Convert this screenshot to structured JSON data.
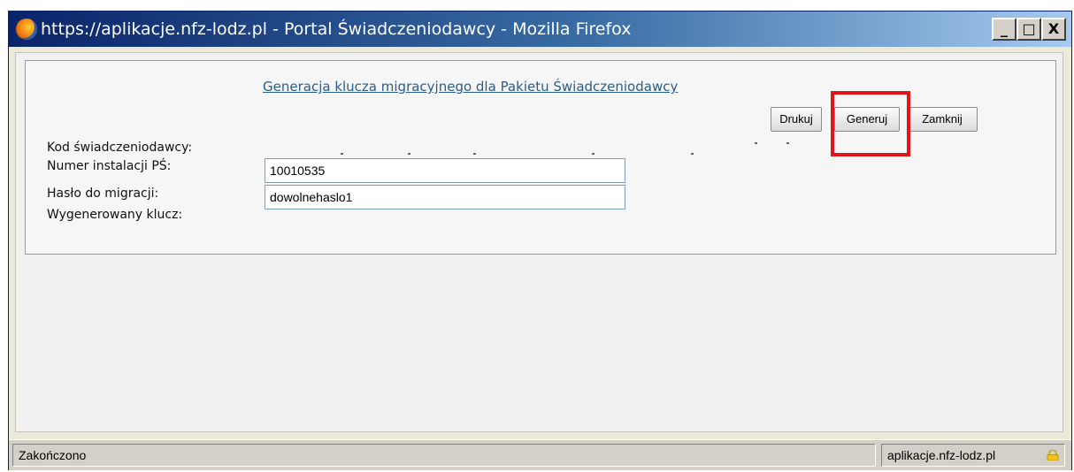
{
  "window": {
    "title": "https://aplikacje.nfz-lodz.pl - Portal Świadczeniodawcy - Mozilla Firefox",
    "controls": {
      "minimize": "_",
      "maximize": "□",
      "close": "X"
    }
  },
  "form": {
    "heading": "Generacja klucza migracyjnego dla Pakietu Świadczeniodawcy",
    "buttons": {
      "print": "Drukuj",
      "generate": "Generuj",
      "close": "Zamknij"
    },
    "fields": {
      "provider_code_label": "Kod świadczeniodawcy:",
      "install_number_label": "Numer instalacji PŚ:",
      "install_number_value": "10010535",
      "password_label": "Hasło do migracji:",
      "password_value": "dowolnehaslo1",
      "generated_key_label": "Wygenerowany klucz:"
    },
    "highlight_color": "#e0151c"
  },
  "statusbar": {
    "status": "Zakończono",
    "domain": "aplikacje.nfz-lodz.pl",
    "icon": "lock-icon"
  }
}
